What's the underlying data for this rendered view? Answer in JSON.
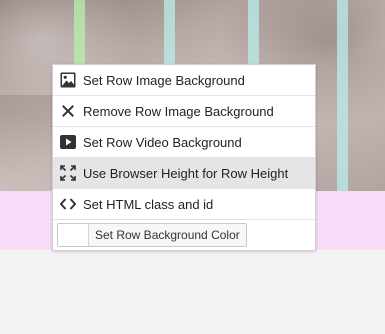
{
  "menu": {
    "items": [
      {
        "label": "Set Row Image Background",
        "icon": "image-icon"
      },
      {
        "label": "Remove Row Image Background",
        "icon": "close-icon"
      },
      {
        "label": "Set Row Video Background",
        "icon": "video-play-icon"
      },
      {
        "label": "Use Browser Height for Row Height",
        "icon": "fullscreen-expand-icon"
      },
      {
        "label": "Set HTML class and id",
        "icon": "code-icon"
      }
    ],
    "color_button": {
      "label": "Set Row Background Color",
      "swatch_color": "#ffffff"
    }
  },
  "colors": {
    "row_pink": "#f7dcf7",
    "guide_green": "#b6f0aa",
    "guide_cyan": "#b9ebe6",
    "active_item_bg": "#e5e5e5"
  }
}
